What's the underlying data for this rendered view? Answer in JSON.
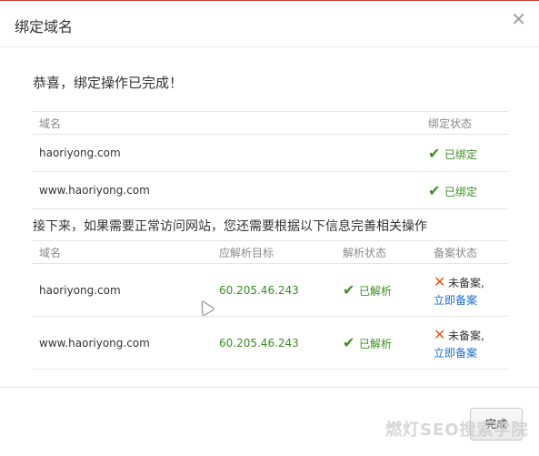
{
  "dialog": {
    "title": "绑定域名",
    "close_icon": "close-icon",
    "close_glyph": "✕"
  },
  "success_message": "恭喜，绑定操作已完成！",
  "bound_table": {
    "headers": [
      "域名",
      "绑定状态"
    ],
    "rows": [
      {
        "domain": "haoriyong.com",
        "status": "已绑定"
      },
      {
        "domain": "www.haoriyong.com",
        "status": "已绑定"
      }
    ]
  },
  "next_steps_message": "接下来，如果需要正常访问网站，您还需要根据以下信息完善相关操作",
  "dns_table": {
    "headers": [
      "域名",
      "应解析目标",
      "解析状态",
      "备案状态"
    ],
    "rows": [
      {
        "domain": "haoriyong.com",
        "target": "60.205.46.243",
        "dns_status": "已解析",
        "record_status": "未备案,",
        "record_link": "立即备案"
      },
      {
        "domain": "www.haoriyong.com",
        "target": "60.205.46.243",
        "dns_status": "已解析",
        "record_status": "未备案,",
        "record_link": "立即备案"
      }
    ]
  },
  "footer": {
    "done_label": "完成"
  },
  "watermark": "燃灯SEO搜索学院",
  "icons": {
    "check": "✔",
    "cross": "✕"
  },
  "colors": {
    "success_green": "#3a8f1f",
    "link_blue": "#1a6fd1",
    "cross_orange": "#e05a1f"
  }
}
